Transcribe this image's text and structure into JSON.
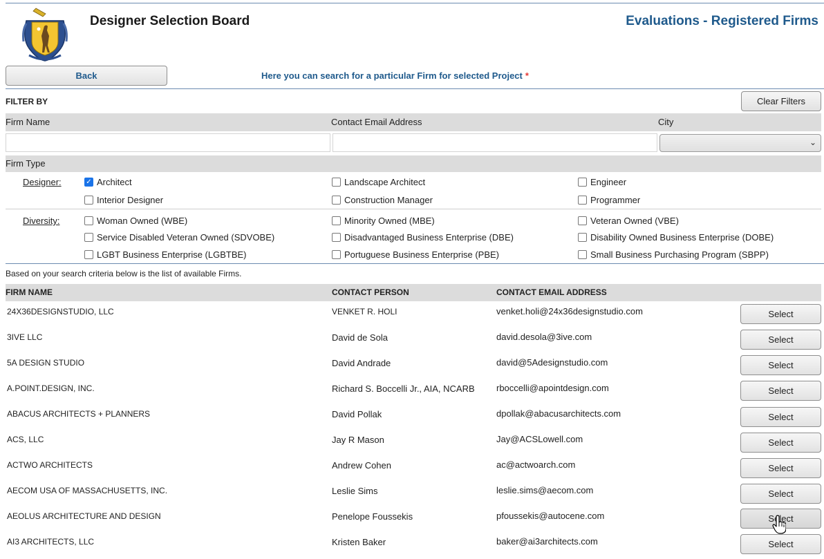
{
  "header": {
    "app_title": "Designer Selection Board",
    "page_title": "Evaluations - Registered Firms",
    "logo": "massachusetts-state-seal"
  },
  "toolbar": {
    "back_label": "Back",
    "hint": "Here you can search for a particular Firm for selected Project",
    "required_mark": "*"
  },
  "filters": {
    "title": "FILTER BY",
    "clear_label": "Clear Filters",
    "firm_name_label": "Firm Name",
    "contact_email_label": "Contact Email Address",
    "city_label": "City",
    "firm_name_value": "",
    "contact_email_value": "",
    "city_selected": "",
    "firm_type_label": "Firm Type",
    "designer_label": "Designer:",
    "diversity_label": "Diversity:",
    "designer_options": [
      {
        "label": "Architect",
        "checked": true
      },
      {
        "label": "Landscape Architect",
        "checked": false
      },
      {
        "label": "Engineer",
        "checked": false
      },
      {
        "label": "Interior Designer",
        "checked": false
      },
      {
        "label": "Construction Manager",
        "checked": false
      },
      {
        "label": "Programmer",
        "checked": false
      }
    ],
    "diversity_options": [
      {
        "label": "Woman Owned (WBE)",
        "checked": false
      },
      {
        "label": "Minority Owned (MBE)",
        "checked": false
      },
      {
        "label": "Veteran Owned (VBE)",
        "checked": false
      },
      {
        "label": "Service Disabled Veteran Owned (SDVOBE)",
        "checked": false
      },
      {
        "label": "Disadvantaged Business Enterprise (DBE)",
        "checked": false
      },
      {
        "label": "Disability Owned Business Enterprise (DOBE)",
        "checked": false
      },
      {
        "label": "LGBT Business Enterprise (LGBTBE)",
        "checked": false
      },
      {
        "label": "Portuguese Business Enterprise (PBE)",
        "checked": false
      },
      {
        "label": "Small Business Purchasing Program (SBPP)",
        "checked": false
      }
    ]
  },
  "results": {
    "note": "Based on your search criteria below is the list of available Firms.",
    "columns": {
      "firm": "FIRM NAME",
      "contact": "CONTACT PERSON",
      "email": "CONTACT EMAIL ADDRESS"
    },
    "select_label": "Select",
    "rows": [
      {
        "firm": "24X36DESIGNSTUDIO, LLC",
        "contact": "VENKET R. HOLI",
        "email": "venket.holi@24x36designstudio.com"
      },
      {
        "firm": "3IVE LLC",
        "contact": "David de Sola",
        "email": "david.desola@3ive.com"
      },
      {
        "firm": "5A DESIGN STUDIO",
        "contact": "David Andrade",
        "email": "david@5Adesignstudio.com"
      },
      {
        "firm": "A.POINT.DESIGN, INC.",
        "contact": "Richard S. Boccelli Jr., AIA, NCARB",
        "email": "rboccelli@apointdesign.com"
      },
      {
        "firm": "ABACUS ARCHITECTS + PLANNERS",
        "contact": "David Pollak",
        "email": "dpollak@abacusarchitects.com"
      },
      {
        "firm": "ACS, LLC",
        "contact": "Jay R Mason",
        "email": "Jay@ACSLowell.com"
      },
      {
        "firm": "ACTWO ARCHITECTS",
        "contact": "Andrew Cohen",
        "email": "ac@actwoarch.com"
      },
      {
        "firm": "AECOM USA OF MASSACHUSETTS, INC.",
        "contact": "Leslie Sims",
        "email": "leslie.sims@aecom.com"
      },
      {
        "firm": "AEOLUS ARCHITECTURE AND DESIGN",
        "contact": "Penelope Foussekis",
        "email": "pfoussekis@autocene.com"
      },
      {
        "firm": "AI3 ARCHITECTS, LLC",
        "contact": "Kristen Baker",
        "email": "baker@ai3architects.com"
      }
    ]
  },
  "colors": {
    "accent": "#1f5a8c",
    "required": "#e53935",
    "checkbox": "#1a73e8",
    "header_bar": "#dcdcdc"
  }
}
